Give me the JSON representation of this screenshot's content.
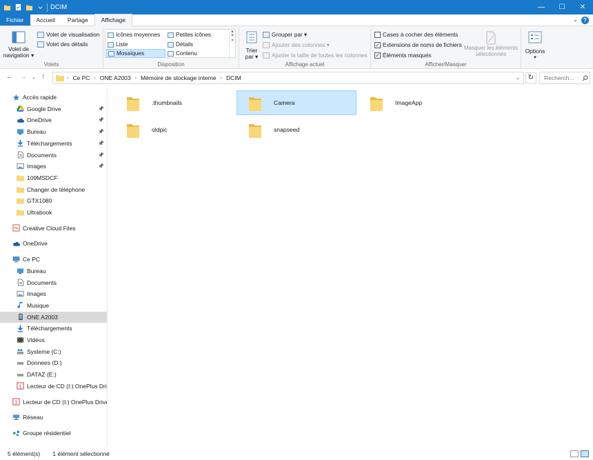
{
  "window": {
    "title": "DCIM",
    "controls": {
      "minimize": "—",
      "maximize": "☐",
      "close": "✕"
    }
  },
  "tabs": [
    {
      "label": "Fichier"
    },
    {
      "label": "Accueil"
    },
    {
      "label": "Partage"
    },
    {
      "label": "Affichage"
    }
  ],
  "ribbon": {
    "volets": {
      "label": "Volets",
      "nav_pane_line1": "Volet de",
      "nav_pane_line2": "navigation ▾",
      "preview_pane": "Volet de visualisation",
      "details_pane": "Volet des détails"
    },
    "disposition": {
      "label": "Disposition",
      "items": [
        "Icônes moyennes",
        "Petites icônes",
        "Liste",
        "Détails",
        "Mosaïques",
        "Contenu"
      ],
      "selected": "Mosaïques"
    },
    "affichage_actuel": {
      "label": "Affichage actuel",
      "sort_line1": "Trier",
      "sort_line2": "par ▾",
      "group_by": "Grouper par ▾",
      "add_columns": "Ajouter des colonnes ▾",
      "fit_columns": "Ajuster la taille de toutes les colonnes"
    },
    "afficher_masquer": {
      "label": "Afficher/Masquer",
      "checkboxes": [
        {
          "label": "Cases à cocher des éléments",
          "checked": false
        },
        {
          "label": "Extensions de noms de fichiers",
          "checked": true
        },
        {
          "label": "Éléments masqués",
          "checked": true
        }
      ],
      "hide_selected_line1": "Masquer les éléments",
      "hide_selected_line2": "sélectionnés"
    },
    "options": {
      "label": "Options",
      "arrow": "▾"
    }
  },
  "address": {
    "crumbs": [
      "Ce PC",
      "ONE A2003",
      "Mémoire de stockage interne",
      "DCIM"
    ],
    "search_placeholder": "Recherch...",
    "back": "←",
    "forward": "→",
    "recent": "⌄",
    "up": "↑",
    "refresh": "↻",
    "dropdown": "⌄"
  },
  "nav_pane": {
    "items": [
      {
        "label": "Accès rapide",
        "icon": "star-icon",
        "indent": 1,
        "pinned": false,
        "selected": false
      },
      {
        "label": "Google Drive",
        "icon": "google-drive-icon",
        "indent": 2,
        "pinned": true,
        "selected": false
      },
      {
        "label": "OneDrive",
        "icon": "cloud-icon",
        "indent": 2,
        "pinned": true,
        "selected": false
      },
      {
        "label": "Bureau",
        "icon": "desktop-icon",
        "indent": 2,
        "pinned": true,
        "selected": false
      },
      {
        "label": "Téléchargements",
        "icon": "download-icon",
        "indent": 2,
        "pinned": true,
        "selected": false
      },
      {
        "label": "Documents",
        "icon": "document-icon",
        "indent": 2,
        "pinned": true,
        "selected": false
      },
      {
        "label": "Images",
        "icon": "image-icon",
        "indent": 2,
        "pinned": true,
        "selected": false
      },
      {
        "label": "109MSDCF",
        "icon": "folder-icon",
        "indent": 2,
        "pinned": false,
        "selected": false
      },
      {
        "label": "Changer de téléphone",
        "icon": "folder-icon",
        "indent": 2,
        "pinned": false,
        "selected": false
      },
      {
        "label": "GTX1080",
        "icon": "folder-icon",
        "indent": 2,
        "pinned": false,
        "selected": false
      },
      {
        "label": "Ultrabook",
        "icon": "folder-icon",
        "indent": 2,
        "pinned": false,
        "selected": false
      },
      {
        "label": "Creative Cloud Files",
        "icon": "creative-cloud-icon",
        "indent": 1,
        "pinned": false,
        "selected": false,
        "gap": true
      },
      {
        "label": "OneDrive",
        "icon": "cloud-icon",
        "indent": 1,
        "pinned": false,
        "selected": false,
        "gap": true
      },
      {
        "label": "Ce PC",
        "icon": "computer-icon",
        "indent": 1,
        "pinned": false,
        "selected": false,
        "gap": true
      },
      {
        "label": "Bureau",
        "icon": "desktop-icon",
        "indent": 2,
        "pinned": false,
        "selected": false
      },
      {
        "label": "Documents",
        "icon": "document-icon",
        "indent": 2,
        "pinned": false,
        "selected": false
      },
      {
        "label": "Images",
        "icon": "image-icon",
        "indent": 2,
        "pinned": false,
        "selected": false
      },
      {
        "label": "Musique",
        "icon": "music-icon",
        "indent": 2,
        "pinned": false,
        "selected": false
      },
      {
        "label": "ONE A2003",
        "icon": "phone-icon",
        "indent": 2,
        "pinned": false,
        "selected": true
      },
      {
        "label": "Téléchargements",
        "icon": "download-icon",
        "indent": 2,
        "pinned": false,
        "selected": false
      },
      {
        "label": "Vidéos",
        "icon": "video-icon",
        "indent": 2,
        "pinned": false,
        "selected": false
      },
      {
        "label": "Systeme (C:)",
        "icon": "windows-drive-icon",
        "indent": 2,
        "pinned": false,
        "selected": false
      },
      {
        "label": "Donnees (D:)",
        "icon": "drive-icon",
        "indent": 2,
        "pinned": false,
        "selected": false
      },
      {
        "label": "DATAZ (E:)",
        "icon": "drive-icon",
        "indent": 2,
        "pinned": false,
        "selected": false
      },
      {
        "label": "Lecteur de CD (I:) OnePlus Drive",
        "icon": "cd-drive-icon",
        "indent": 2,
        "pinned": false,
        "selected": false
      },
      {
        "label": "Lecteur de CD (I:) OnePlus Drivers",
        "icon": "cd-drive-icon",
        "indent": 1,
        "pinned": false,
        "selected": false,
        "gap": true
      },
      {
        "label": "Réseau",
        "icon": "network-icon",
        "indent": 1,
        "pinned": false,
        "selected": false,
        "gap": true
      },
      {
        "label": "Groupe résidentiel",
        "icon": "homegroup-icon",
        "indent": 1,
        "pinned": false,
        "selected": false,
        "gap": true
      }
    ]
  },
  "content": {
    "folders": [
      {
        "name": ".thumbnails",
        "selected": false
      },
      {
        "name": "Camera",
        "selected": true
      },
      {
        "name": "ImageApp",
        "selected": false
      },
      {
        "name": "oldpic",
        "selected": false
      },
      {
        "name": "snapseed",
        "selected": false
      }
    ]
  },
  "status": {
    "count": "5 élément(s)",
    "selection": "1 élément sélectionné"
  },
  "colors": {
    "accent": "#1979ca",
    "selection": "#cce8ff",
    "folder": "#f8d775",
    "folder_dark": "#e8b84a"
  }
}
